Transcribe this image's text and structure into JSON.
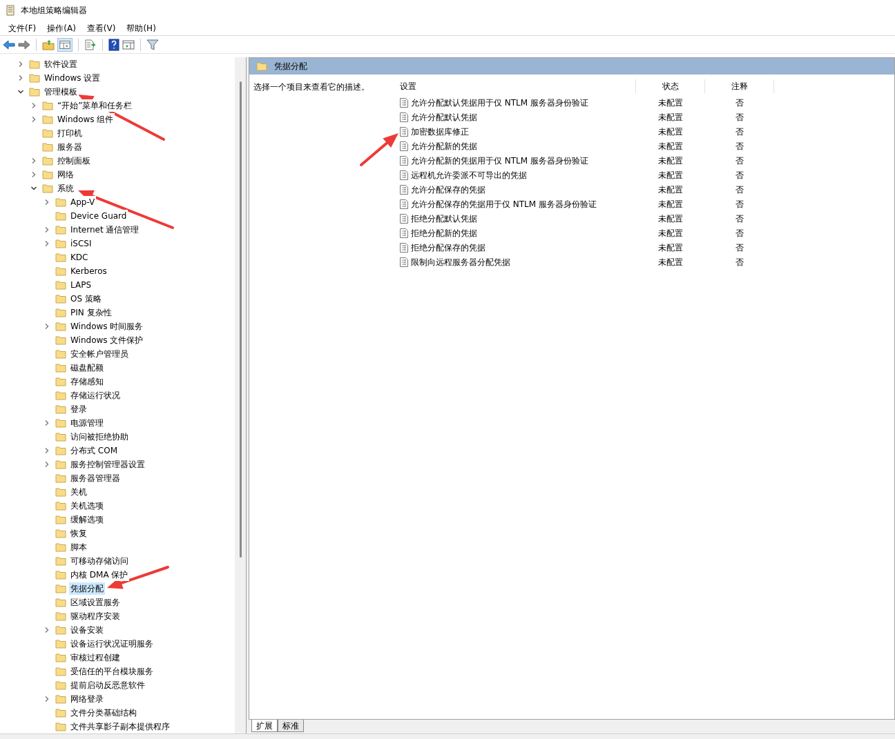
{
  "window": {
    "title": "本地组策略编辑器"
  },
  "menu": [
    "文件(F)",
    "操作(A)",
    "查看(V)",
    "帮助(H)"
  ],
  "tree": [
    {
      "label": "软件设置",
      "kind": "branch",
      "expanded": false,
      "selected": false
    },
    {
      "label": "Windows 设置",
      "kind": "branch",
      "expanded": false,
      "selected": false
    },
    {
      "label": "管理模板",
      "kind": "branch",
      "expanded": true,
      "selected": false,
      "children": [
        {
          "label": "“开始”菜单和任务栏",
          "kind": "branch",
          "expanded": false,
          "selected": false
        },
        {
          "label": "Windows 组件",
          "kind": "branch",
          "expanded": false,
          "selected": false
        },
        {
          "label": "打印机",
          "kind": "leaf",
          "selected": false
        },
        {
          "label": "服务器",
          "kind": "leaf",
          "selected": false
        },
        {
          "label": "控制面板",
          "kind": "branch",
          "expanded": false,
          "selected": false
        },
        {
          "label": "网络",
          "kind": "branch",
          "expanded": false,
          "selected": false
        },
        {
          "label": "系统",
          "kind": "branch",
          "expanded": true,
          "selected": false,
          "children": [
            {
              "label": "App-V",
              "kind": "branch",
              "expanded": false,
              "selected": false
            },
            {
              "label": "Device Guard",
              "kind": "leaf",
              "selected": false
            },
            {
              "label": "Internet 通信管理",
              "kind": "branch",
              "expanded": false,
              "selected": false
            },
            {
              "label": "iSCSI",
              "kind": "branch",
              "expanded": false,
              "selected": false
            },
            {
              "label": "KDC",
              "kind": "leaf",
              "selected": false
            },
            {
              "label": "Kerberos",
              "kind": "leaf",
              "selected": false
            },
            {
              "label": "LAPS",
              "kind": "leaf",
              "selected": false
            },
            {
              "label": "OS 策略",
              "kind": "leaf",
              "selected": false
            },
            {
              "label": "PIN 复杂性",
              "kind": "leaf",
              "selected": false
            },
            {
              "label": "Windows 时间服务",
              "kind": "branch",
              "expanded": false,
              "selected": false
            },
            {
              "label": "Windows 文件保护",
              "kind": "leaf",
              "selected": false
            },
            {
              "label": "安全帐户管理员",
              "kind": "leaf",
              "selected": false
            },
            {
              "label": "磁盘配额",
              "kind": "leaf",
              "selected": false
            },
            {
              "label": "存储感知",
              "kind": "leaf",
              "selected": false
            },
            {
              "label": "存储运行状况",
              "kind": "leaf",
              "selected": false
            },
            {
              "label": "登录",
              "kind": "leaf",
              "selected": false
            },
            {
              "label": "电源管理",
              "kind": "branch",
              "expanded": false,
              "selected": false
            },
            {
              "label": "访问被拒绝协助",
              "kind": "leaf",
              "selected": false
            },
            {
              "label": "分布式 COM",
              "kind": "branch",
              "expanded": false,
              "selected": false
            },
            {
              "label": "服务控制管理器设置",
              "kind": "branch",
              "expanded": false,
              "selected": false
            },
            {
              "label": "服务器管理器",
              "kind": "leaf",
              "selected": false
            },
            {
              "label": "关机",
              "kind": "leaf",
              "selected": false
            },
            {
              "label": "关机选项",
              "kind": "leaf",
              "selected": false
            },
            {
              "label": "缓解选项",
              "kind": "leaf",
              "selected": false
            },
            {
              "label": "恢复",
              "kind": "leaf",
              "selected": false
            },
            {
              "label": "脚本",
              "kind": "leaf",
              "selected": false
            },
            {
              "label": "可移动存储访问",
              "kind": "leaf",
              "selected": false
            },
            {
              "label": "内核 DMA 保护",
              "kind": "leaf",
              "selected": false
            },
            {
              "label": "凭据分配",
              "kind": "leaf",
              "selected": true
            },
            {
              "label": "区域设置服务",
              "kind": "leaf",
              "selected": false
            },
            {
              "label": "驱动程序安装",
              "kind": "leaf",
              "selected": false
            },
            {
              "label": "设备安装",
              "kind": "branch",
              "expanded": false,
              "selected": false
            },
            {
              "label": "设备运行状况证明服务",
              "kind": "leaf",
              "selected": false
            },
            {
              "label": "审核过程创建",
              "kind": "leaf",
              "selected": false
            },
            {
              "label": "受信任的平台模块服务",
              "kind": "leaf",
              "selected": false
            },
            {
              "label": "提前启动反恶意软件",
              "kind": "leaf",
              "selected": false
            },
            {
              "label": "网络登录",
              "kind": "branch",
              "expanded": false,
              "selected": false
            },
            {
              "label": "文件分类基础结构",
              "kind": "leaf",
              "selected": false
            },
            {
              "label": "文件共享影子副本提供程序",
              "kind": "leaf",
              "selected": false
            }
          ]
        }
      ]
    }
  ],
  "details": {
    "header": "凭据分配",
    "description": "选择一个项目来查看它的描述。",
    "columns": [
      "设置",
      "状态",
      "注释"
    ],
    "rows": [
      {
        "name": "允许分配默认凭据用于仅 NTLM 服务器身份验证",
        "state": "未配置",
        "comment": "否"
      },
      {
        "name": "允许分配默认凭据",
        "state": "未配置",
        "comment": "否"
      },
      {
        "name": "加密数据库修正",
        "state": "未配置",
        "comment": "否"
      },
      {
        "name": "允许分配新的凭据",
        "state": "未配置",
        "comment": "否"
      },
      {
        "name": "允许分配新的凭据用于仅 NTLM 服务器身份验证",
        "state": "未配置",
        "comment": "否"
      },
      {
        "name": "远程机允许委派不可导出的凭据",
        "state": "未配置",
        "comment": "否"
      },
      {
        "name": "允许分配保存的凭据",
        "state": "未配置",
        "comment": "否"
      },
      {
        "name": "允许分配保存的凭据用于仅 NTLM 服务器身份验证",
        "state": "未配置",
        "comment": "否"
      },
      {
        "name": "拒绝分配默认凭据",
        "state": "未配置",
        "comment": "否"
      },
      {
        "name": "拒绝分配新的凭据",
        "state": "未配置",
        "comment": "否"
      },
      {
        "name": "拒绝分配保存的凭据",
        "state": "未配置",
        "comment": "否"
      },
      {
        "name": "限制向远程服务器分配凭据",
        "state": "未配置",
        "comment": "否"
      }
    ]
  },
  "tabs": [
    {
      "label": "扩展",
      "selected": true
    },
    {
      "label": "标准",
      "selected": false
    }
  ]
}
